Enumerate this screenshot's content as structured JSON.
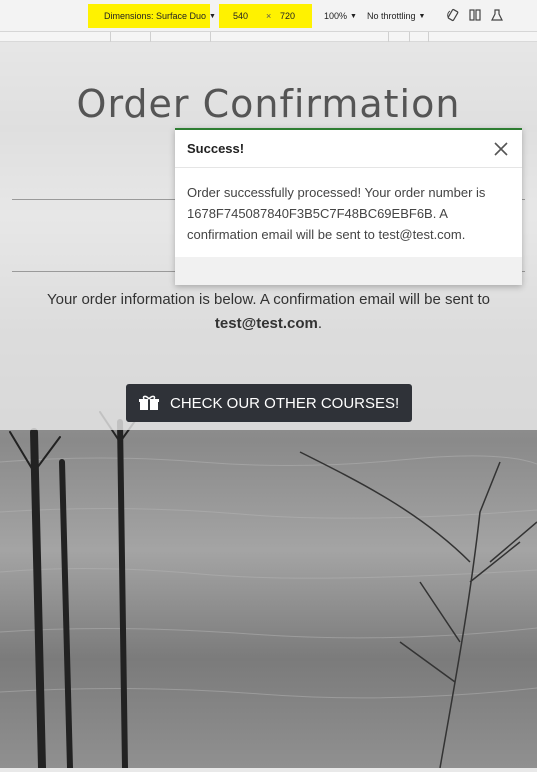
{
  "devtools": {
    "dimensions_label": "Dimensions: Surface Duo",
    "width_value": "540",
    "times": "×",
    "height_value": "720",
    "zoom": "100%",
    "throttle": "No throttling",
    "icons": [
      "rotate-icon",
      "dual-screen-icon",
      "sensors-icon"
    ]
  },
  "page": {
    "title": "Order Confirmation",
    "info_text": "Your order information is below. A confirmation email will be sent to",
    "info_email": "test@test.com",
    "info_end": ".",
    "cta_label": "CHECK OUR OTHER COURSES!"
  },
  "toast": {
    "title": "Success!",
    "message": "Order successfully processed! Your order number is 1678F745087840F3B5C7F48BC69EBF6B. A confirmation email will be sent to test@test.com.",
    "accent": "#2e7d32"
  }
}
